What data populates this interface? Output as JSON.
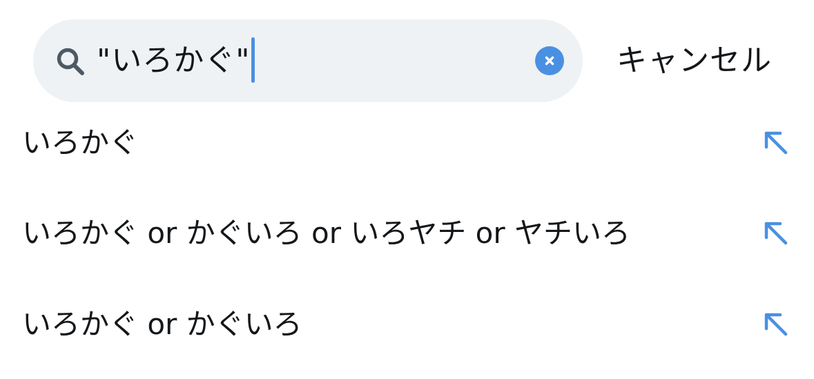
{
  "search": {
    "query": "\"いろかぐ\"",
    "search_icon": "search-icon",
    "clear_icon": "close-circle-icon",
    "accent_color": "#4a90e2",
    "field_background": "#eef2f4"
  },
  "header": {
    "cancel_label": "キャンセル"
  },
  "suggestions": [
    {
      "label": "いろかぐ",
      "icon": "arrow-up-left-icon"
    },
    {
      "label": "いろかぐ or かぐいろ or いろヤチ or ヤチいろ",
      "icon": "arrow-up-left-icon"
    },
    {
      "label": "いろかぐ or かぐいろ",
      "icon": "arrow-up-left-icon"
    }
  ]
}
